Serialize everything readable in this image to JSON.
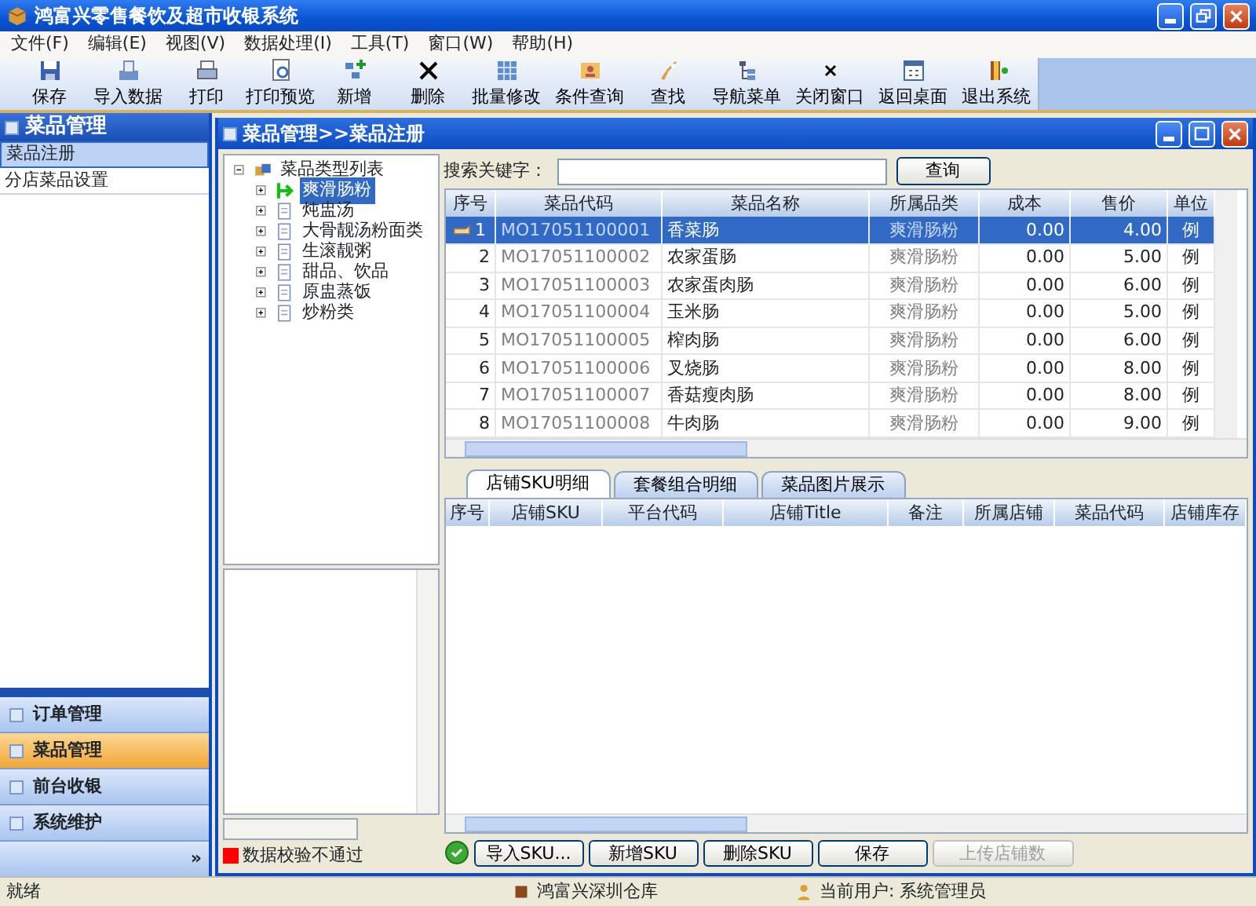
{
  "window": {
    "title": "鸿富兴零售餐饮及超市收银系统"
  },
  "menu": [
    "文件(F)",
    "编辑(E)",
    "视图(V)",
    "数据处理(I)",
    "工具(T)",
    "窗口(W)",
    "帮助(H)"
  ],
  "toolbar": [
    "保存",
    "导入数据",
    "打印",
    "打印预览",
    "新增",
    "删除",
    "批量修改",
    "条件查询",
    "查找",
    "导航菜单",
    "关闭窗口",
    "返回桌面",
    "退出系统"
  ],
  "sidebar": {
    "title": "菜品管理",
    "items": [
      {
        "label": "菜品注册",
        "selected": true
      },
      {
        "label": "分店菜品设置",
        "selected": false
      }
    ],
    "modules": [
      {
        "label": "订单管理",
        "selected": false
      },
      {
        "label": "菜品管理",
        "selected": true
      },
      {
        "label": "前台收银",
        "selected": false
      },
      {
        "label": "系统维护",
        "selected": false
      }
    ],
    "more": "»"
  },
  "child_window": {
    "title": "菜品管理>>菜品注册"
  },
  "tree": {
    "label": "菜品类型列表",
    "expanded": true,
    "children": [
      {
        "label": "爽滑肠粉",
        "selected": true,
        "expanded": false
      },
      {
        "label": "炖盅汤",
        "selected": false,
        "expanded": false
      },
      {
        "label": "大骨靓汤粉面类",
        "selected": false,
        "expanded": false
      },
      {
        "label": "生滚靓粥",
        "selected": false,
        "expanded": false
      },
      {
        "label": "甜品、饮品",
        "selected": false,
        "expanded": false
      },
      {
        "label": "原盅蒸饭",
        "selected": false,
        "expanded": false
      },
      {
        "label": "炒粉类",
        "selected": false,
        "expanded": false
      }
    ]
  },
  "validation": {
    "label": "数据校验不通过"
  },
  "search": {
    "label": "搜索关键字：",
    "button": "查询"
  },
  "grid": {
    "columns": [
      "序号",
      "菜品代码",
      "菜品名称",
      "所属品类",
      "成本",
      "售价",
      "单位"
    ],
    "rows": [
      {
        "selected": true,
        "cells": [
          "1",
          "MO17051100001",
          "香菜肠",
          "爽滑肠粉",
          "0.00",
          "4.00",
          "例"
        ]
      },
      {
        "selected": false,
        "cells": [
          "2",
          "MO17051100002",
          "农家蛋肠",
          "爽滑肠粉",
          "0.00",
          "5.00",
          "例"
        ]
      },
      {
        "selected": false,
        "cells": [
          "3",
          "MO17051100003",
          "农家蛋肉肠",
          "爽滑肠粉",
          "0.00",
          "6.00",
          "例"
        ]
      },
      {
        "selected": false,
        "cells": [
          "4",
          "MO17051100004",
          "玉米肠",
          "爽滑肠粉",
          "0.00",
          "5.00",
          "例"
        ]
      },
      {
        "selected": false,
        "cells": [
          "5",
          "MO17051100005",
          "榨肉肠",
          "爽滑肠粉",
          "0.00",
          "6.00",
          "例"
        ]
      },
      {
        "selected": false,
        "cells": [
          "6",
          "MO17051100006",
          "叉烧肠",
          "爽滑肠粉",
          "0.00",
          "8.00",
          "例"
        ]
      },
      {
        "selected": false,
        "cells": [
          "7",
          "MO17051100007",
          "香菇瘦肉肠",
          "爽滑肠粉",
          "0.00",
          "8.00",
          "例"
        ]
      },
      {
        "selected": false,
        "cells": [
          "8",
          "MO17051100008",
          "牛肉肠",
          "爽滑肠粉",
          "0.00",
          "9.00",
          "例"
        ]
      }
    ]
  },
  "tabs": [
    {
      "label": "店铺SKU明细",
      "selected": true
    },
    {
      "label": "套餐组合明细",
      "selected": false
    },
    {
      "label": "菜品图片展示",
      "selected": false
    }
  ],
  "sku_grid": {
    "columns": [
      "序号",
      "店铺SKU",
      "平台代码",
      "店铺Title",
      "备注",
      "所属店铺",
      "菜品代码",
      "店铺库存"
    ]
  },
  "buttons": [
    {
      "label": "导入SKU...",
      "disabled": false
    },
    {
      "label": "新增SKU",
      "disabled": false
    },
    {
      "label": "删除SKU",
      "disabled": false
    },
    {
      "label": "保存",
      "disabled": false
    },
    {
      "label": "上传店铺数",
      "disabled": true
    }
  ],
  "status_bar": {
    "message": "就绪",
    "warehouse": "鸿富兴深圳仓库",
    "user": "当前用户: 系统管理员"
  }
}
